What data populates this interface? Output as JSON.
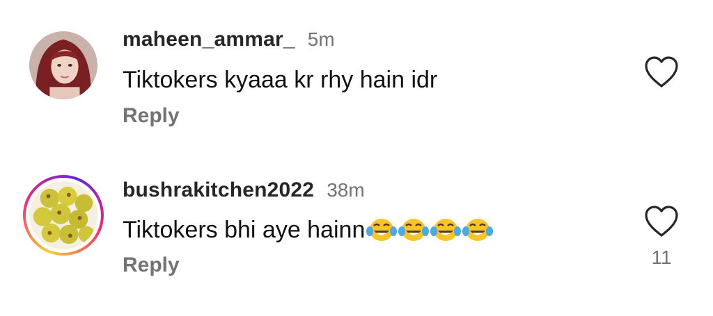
{
  "comments": [
    {
      "username": "maheen_ammar_",
      "time": "5m",
      "text": "Tiktokers kyaaa kr rhy hain idr",
      "reply_label": "Reply",
      "like_count": ""
    },
    {
      "username": "bushrakitchen2022",
      "time": "38m",
      "text": "Tiktokers bhi aye hainn",
      "emojis": [
        "face-with-tears-of-joy",
        "face-with-tears-of-joy",
        "face-with-tears-of-joy",
        "face-with-tears-of-joy"
      ],
      "reply_label": "Reply",
      "like_count": "11"
    }
  ],
  "icons": {
    "like": "heart-outline-icon",
    "emoji": "face-with-tears-of-joy"
  },
  "colors": {
    "username": "#262626",
    "muted": "#737373",
    "text": "#111111",
    "story_ring_start": "#f9ce34",
    "story_ring_mid": "#ee2a7b",
    "story_ring_end": "#6228d7"
  }
}
